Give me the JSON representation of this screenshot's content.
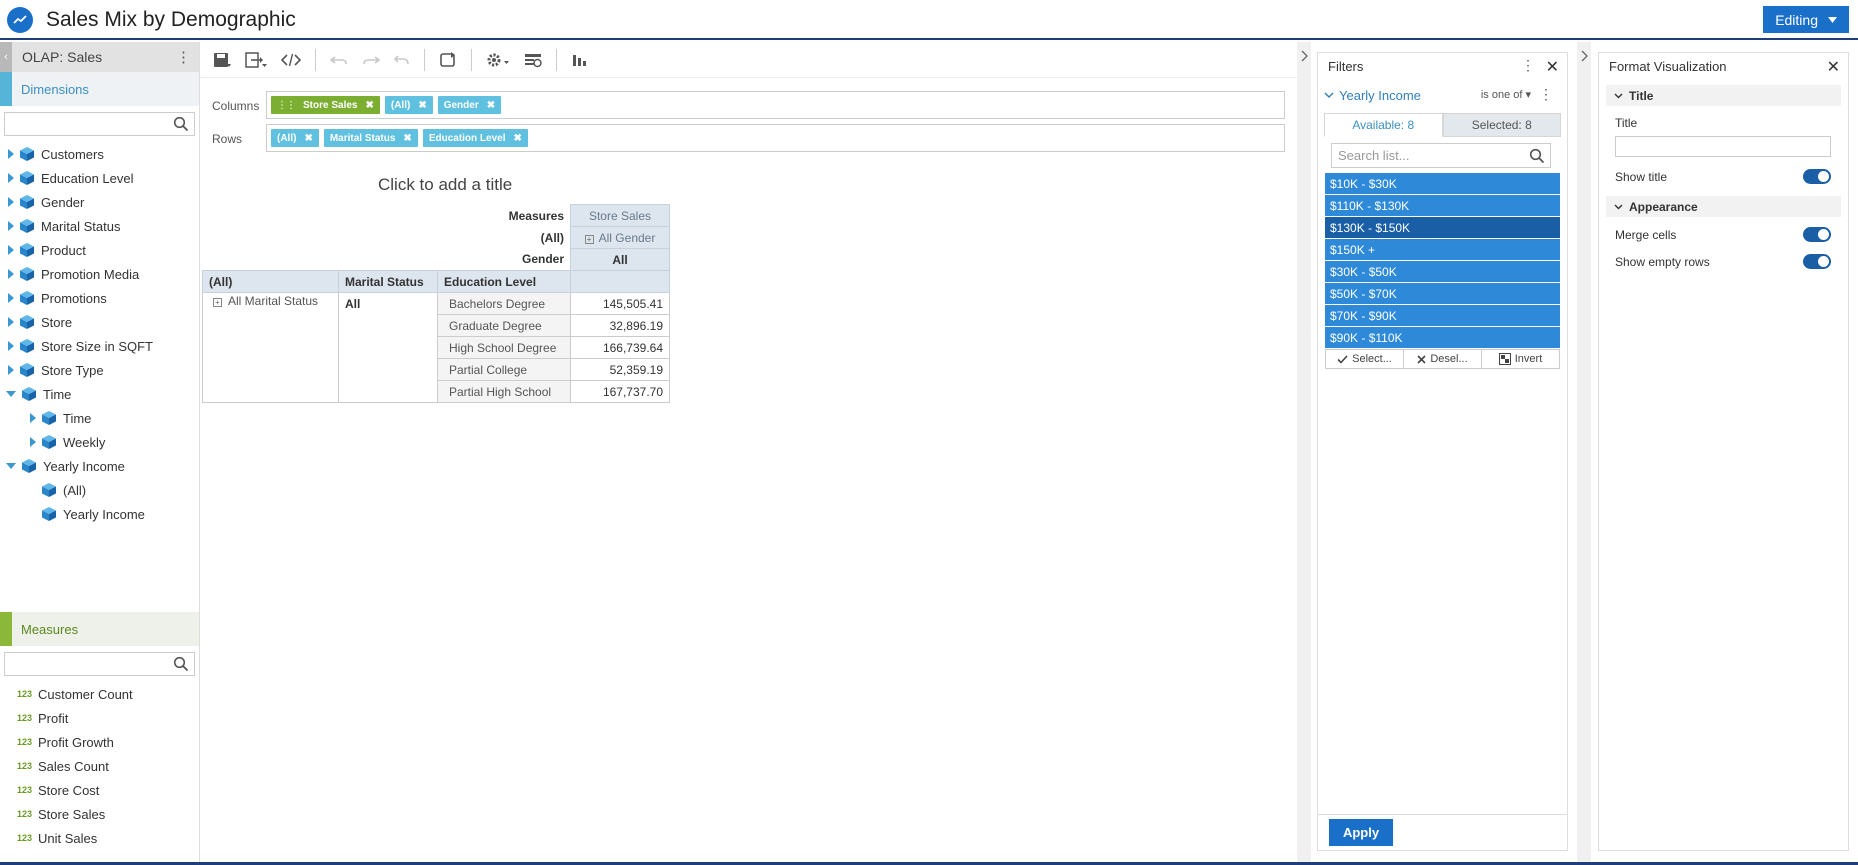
{
  "header": {
    "title": "Sales Mix by Demographic",
    "mode_label": "Editing"
  },
  "left_panel": {
    "title": "OLAP: Sales",
    "dimensions_label": "Dimensions",
    "dimensions": [
      "Customers",
      "Education Level",
      "Gender",
      "Marital Status",
      "Product",
      "Promotion Media",
      "Promotions",
      "Store",
      "Store Size in SQFT",
      "Store Type"
    ],
    "time": {
      "label": "Time",
      "children": [
        "Time",
        "Weekly"
      ]
    },
    "yearly_income": {
      "label": "Yearly Income",
      "children": [
        "(All)",
        "Yearly Income"
      ]
    },
    "measures_label": "Measures",
    "measure_icon": "123",
    "measures": [
      "Customer Count",
      "Profit",
      "Profit Growth",
      "Sales Count",
      "Store Cost",
      "Store Sales",
      "Unit Sales"
    ]
  },
  "drop_zones": {
    "columns_label": "Columns",
    "rows_label": "Rows",
    "columns": [
      "Store Sales",
      "(All)",
      "Gender"
    ],
    "rows": [
      "(All)",
      "Marital Status",
      "Education Level"
    ]
  },
  "pivot": {
    "title_placeholder": "Click to add a title",
    "measures_label": "Measures",
    "all_label": "(All)",
    "gender_label": "Gender",
    "measure_value": "Store Sales",
    "all_gender": "All Gender",
    "gender_value": "All",
    "row_headers": [
      "(All)",
      "Marital Status",
      "Education Level"
    ],
    "all_marital_status": "All Marital Status",
    "marital_value": "All",
    "rows": [
      {
        "label": "Bachelors Degree",
        "value": "145,505.41"
      },
      {
        "label": "Graduate Degree",
        "value": "32,896.19"
      },
      {
        "label": "High School Degree",
        "value": "166,739.64"
      },
      {
        "label": "Partial College",
        "value": "52,359.19"
      },
      {
        "label": "Partial High School",
        "value": "167,737.70"
      }
    ]
  },
  "filters": {
    "title": "Filters",
    "field": "Yearly Income",
    "operator": "is one of",
    "available_tab": "Available: 8",
    "selected_tab": "Selected: 8",
    "search_placeholder": "Search list...",
    "items": [
      "$10K - $30K",
      "$110K - $130K",
      "$130K - $150K",
      "$150K +",
      "$30K - $50K",
      "$50K - $70K",
      "$70K - $90K",
      "$90K - $110K"
    ],
    "highlighted_index": 2,
    "actions": {
      "select": "Select...",
      "deselect": "Desel...",
      "invert": "Invert"
    },
    "apply_label": "Apply"
  },
  "format": {
    "title": "Format Visualization",
    "title_section": "Title",
    "title_field_label": "Title",
    "title_value": "",
    "show_title_label": "Show title",
    "show_title": true,
    "appearance_section": "Appearance",
    "merge_cells_label": "Merge cells",
    "merge_cells": true,
    "show_empty_rows_label": "Show empty rows",
    "show_empty_rows": true
  },
  "colors": {
    "accent": "#1a6fc9",
    "chip": "#5fc0e0",
    "measure_chip": "#7cae32",
    "filter_item": "#2e8ad8",
    "filter_item_selected": "#1a5fa6"
  }
}
